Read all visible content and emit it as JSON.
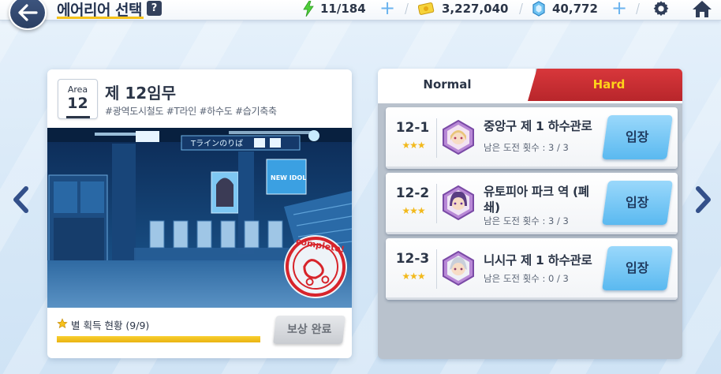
{
  "header": {
    "title": "에어리어 선택",
    "help_label": "?"
  },
  "resources": {
    "energy": "11/184",
    "credits": "3,227,040",
    "gems": "40,772"
  },
  "mission": {
    "area_label": "Area",
    "area_number": "12",
    "title": "제 12임무",
    "tags": "#광역도시철도 #T라인 #하수도 #습기축축",
    "scene_signs": {
      "station_sign": "Tラインのりば",
      "ad_sign": "NEW IDOL",
      "stamp_text": "complete!"
    },
    "star_status": "별 획득 현황 (9/9)",
    "star_progress": 1.0,
    "reward_button": "보상 완료"
  },
  "tabs": {
    "normal": "Normal",
    "hard": "Hard",
    "active": "hard"
  },
  "stages": [
    {
      "id": "12-1",
      "stars": "★★★",
      "name": "중앙구 제 1 하수관로",
      "tries": "남은 도전 횟수 : 3 / 3",
      "enter": "입장"
    },
    {
      "id": "12-2",
      "stars": "★★★",
      "name": "유토피아 파크 역 (폐쇄)",
      "tries": "남은 도전 횟수 : 3 / 3",
      "enter": "입장"
    },
    {
      "id": "12-3",
      "stars": "★★★",
      "name": "니시구 제 1 하수관로",
      "tries": "남은 도전 횟수 : 0 / 3",
      "enter": "입장"
    }
  ],
  "colors": {
    "accent_yellow": "#f5c21a",
    "hard_red": "#c62d31",
    "enter_blue": "#6cc2f3",
    "navy": "#2b3547"
  }
}
